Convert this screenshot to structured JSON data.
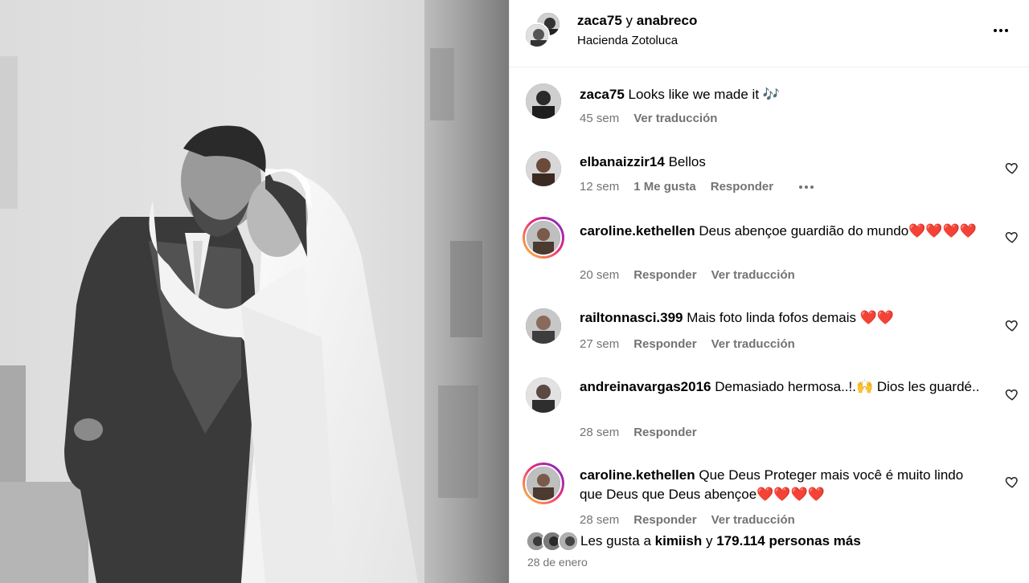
{
  "header": {
    "user1": "zaca75",
    "conjunction": "y",
    "user2": "anabreco",
    "location": "Hacienda Zotoluca"
  },
  "comments": [
    {
      "username": "zaca75",
      "text": "Looks like we made it 🎶",
      "time": "45 sem",
      "actions": [
        "Ver traducción"
      ]
    },
    {
      "username": "elbanaizzir14",
      "text": "Bellos",
      "time": "12 sem",
      "actions": [
        "1 Me gusta",
        "Responder"
      ]
    },
    {
      "username": "caroline.kethellen",
      "text": "Deus abençoe guardião do mundo❤️❤️❤️❤️",
      "time": "20 sem",
      "actions": [
        "Responder",
        "Ver traducción"
      ]
    },
    {
      "username": "railtonnasci.399",
      "text": "Mais foto linda fofos demais ❤️❤️",
      "time": "27 sem",
      "actions": [
        "Responder",
        "Ver traducción"
      ]
    },
    {
      "username": "andreinavargas2016",
      "text": "Demasiado hermosa..!.🙌 Dios les guardé..",
      "time": "28 sem",
      "actions": [
        "Responder"
      ]
    },
    {
      "username": "caroline.kethellen",
      "text": "Que Deus Proteger mais você é muito lindo que Deus que Deus abençoe❤️❤️❤️❤️",
      "time": "28 sem",
      "actions": [
        "Responder",
        "Ver traducción"
      ]
    }
  ],
  "likes": {
    "prefix": "Les gusta a",
    "user": "kimiish",
    "conjunction": "y",
    "others": "179.114 personas más"
  },
  "date": "28 de enero",
  "icons": {
    "more": "more-horizontal-icon",
    "heart": "heart-outline-icon"
  },
  "colors": {
    "secondary_text": "#737373",
    "divider": "#efefef",
    "story_ring": [
      "#f9ce34",
      "#ee2a7b",
      "#6228d7"
    ]
  }
}
